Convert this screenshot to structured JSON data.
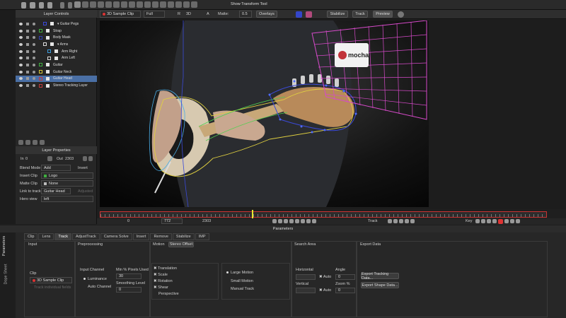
{
  "toolbar": {
    "clip_select": "3D Sample Clip",
    "quality": "Full",
    "mode_letter": "R",
    "mode_3d": "3D",
    "mode_a": "A",
    "matte_label": "Matte:",
    "matte_value": "0.5",
    "overlays": "Overlays",
    "stabilize": "Stabilize",
    "track": "Track",
    "preview": "Preview",
    "show_transform_tool": "Show Transform Tool"
  },
  "layer_controls": {
    "title": "Layer Controls",
    "layers": [
      {
        "name": "Guitar Pegs",
        "color": "#3b4ad9",
        "indent": 1,
        "group": true
      },
      {
        "name": "Strap",
        "color": "#3fae3f",
        "indent": 0
      },
      {
        "name": "Body Mask",
        "color": "#2f3fb0",
        "indent": 0
      },
      {
        "name": "Arms",
        "color": "#dddddd",
        "indent": 1,
        "group": true
      },
      {
        "name": "Arm Right",
        "color": "#3b9bdc",
        "indent": 2
      },
      {
        "name": "Arm Left",
        "color": "#dddddd",
        "indent": 2
      },
      {
        "name": "Guitar",
        "color": "#3fae3f",
        "indent": 0
      },
      {
        "name": "Guitar Neck",
        "color": "#d8c93b",
        "indent": 0
      },
      {
        "name": "Guitar Head",
        "color": "#c03a3a",
        "indent": 0,
        "selected": true
      },
      {
        "name": "Stereo Tracking Layer",
        "color": "#c03a3a",
        "indent": 0
      }
    ]
  },
  "layer_properties": {
    "title": "Layer Properties",
    "in_label": "In",
    "in_value": "0",
    "out_label": "Out",
    "out_value": "2303",
    "invert_label": "Invert",
    "blend_mode_label": "Blend Mode",
    "blend_mode_value": "Add",
    "insert_clip_label": "Insert Clip",
    "insert_clip_value": "Logo",
    "matte_clip_label": "Matte Clip",
    "matte_clip_value": "None",
    "link_track_label": "Link to track",
    "link_track_value": "Guitar Head",
    "link_track_extra": "Adjusted",
    "hero_view_label": "Hero view",
    "hero_view_value": "left"
  },
  "viewer": {
    "logo_text": "mocha"
  },
  "timeline": {
    "start": "0",
    "current": "772",
    "end": "2303",
    "track_label": "Track",
    "key_label": "Key",
    "playhead_fraction": 0.34
  },
  "parameters": {
    "title": "Parameters",
    "tabs": [
      "Clip",
      "Lens",
      "Track",
      "AdjustTrack",
      "Camera Solve",
      "Insert",
      "Remove",
      "Stabilize",
      "IMP"
    ],
    "active_tab": "Track",
    "side_tabs": [
      "Parameters",
      "Dope Sheet"
    ],
    "input": {
      "title": "Input",
      "clip_label": "Clip",
      "clip_value": "3D Sample Clip",
      "track_individual": "Track individual fields"
    },
    "preprocessing": {
      "title": "Preprocessing",
      "input_channel_label": "Input Channel",
      "luminance": "Luminance",
      "auto_channel": "Auto Channel",
      "min_pixels_label": "Min % Pixels Used",
      "min_pixels_value": "30",
      "smoothing_label": "Smoothing Level",
      "smoothing_value": "0"
    },
    "motion": {
      "title": "Motion",
      "tab_stereo": "Stereo Offset",
      "translation": "Translation",
      "scale": "Scale",
      "rotation": "Rotation",
      "shear": "Shear",
      "perspective": "Perspective",
      "large_motion": "Large Motion",
      "small_motion": "Small Motion",
      "manual_track": "Manual Track"
    },
    "search_area": {
      "title": "Search Area",
      "horizontal_label": "Horizontal",
      "vertical_label": "Vertical",
      "auto": "Auto",
      "angle_label": "Angle",
      "angle_value": "0",
      "zoom_label": "Zoom %",
      "zoom_value": "0"
    },
    "export_data": {
      "title": "Export Data",
      "export_tracking": "Export Tracking Data...",
      "export_shape": "Export Shape Data..."
    }
  }
}
